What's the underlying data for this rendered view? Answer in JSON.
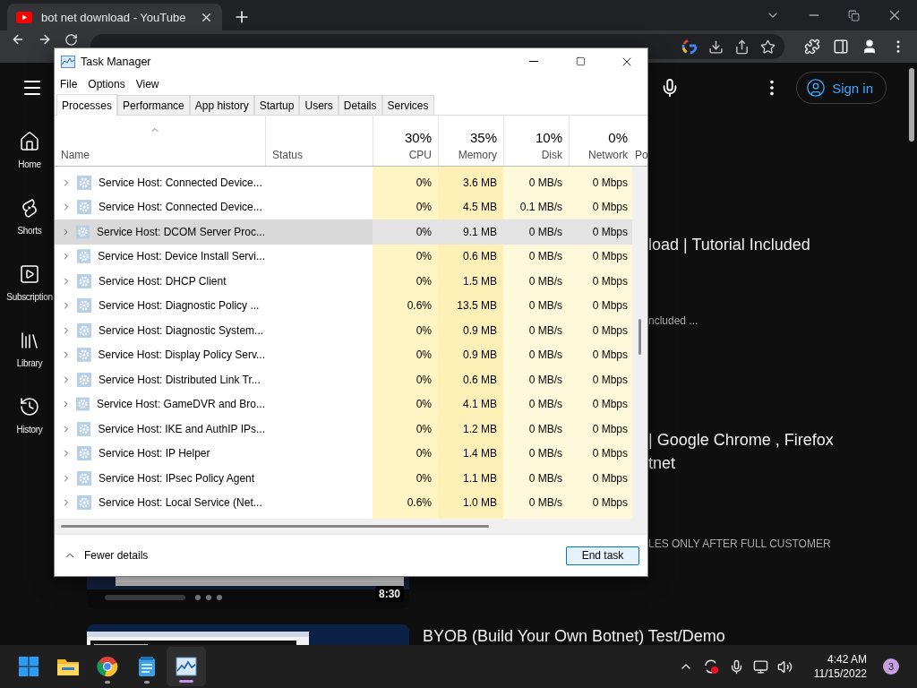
{
  "browser": {
    "tab_title": "bot net download - YouTube"
  },
  "youtube": {
    "sign_in": "Sign in",
    "sidebar": [
      {
        "kind": "home",
        "label": "Home"
      },
      {
        "kind": "shorts",
        "label": "Shorts"
      },
      {
        "kind": "subscriptions",
        "label": "Subscription"
      },
      {
        "kind": "library",
        "label": "Library"
      },
      {
        "kind": "history",
        "label": "History"
      }
    ],
    "results": [
      {
        "partly_hidden": true,
        "title_lines": [
          "load | Tutorial Included"
        ],
        "snippet": "ncluded ..."
      },
      {
        "partly_hidden": true,
        "thumbnail": {
          "kind": "picture"
        },
        "duration": "8:30",
        "title_lines": [
          "| Google Chrome , Firefox",
          "tnet"
        ],
        "description": "LES ONLY AFTER FULL CUSTOMER"
      },
      {
        "partly_hidden": false,
        "thumbnail": {
          "kind": "picture"
        },
        "title_lines": [
          "BYOB (Build Your Own Botnet) Test/Demo"
        ]
      }
    ]
  },
  "task_manager": {
    "title": "Task Manager",
    "menu": [
      "File",
      "Options",
      "View"
    ],
    "tabs": [
      {
        "label": "Processes",
        "selected": true
      },
      {
        "label": "Performance",
        "selected": false
      },
      {
        "label": "App history",
        "selected": false
      },
      {
        "label": "Startup",
        "selected": false
      },
      {
        "label": "Users",
        "selected": false
      },
      {
        "label": "Details",
        "selected": false
      },
      {
        "label": "Services",
        "selected": false
      }
    ],
    "columns": [
      {
        "label": "Name"
      },
      {
        "label": "Status"
      },
      {
        "label": "CPU",
        "total": "30%"
      },
      {
        "label": "Memory",
        "total": "35%"
      },
      {
        "label": "Disk",
        "total": "10%"
      },
      {
        "label": "Network",
        "total": "0%"
      },
      {
        "label": "Po"
      }
    ],
    "rows": [
      {
        "name": "Service Host: Connected Device...",
        "cpu": "0%",
        "memory": "3.6 MB",
        "disk": "0 MB/s",
        "network": "0 Mbps",
        "selected": false
      },
      {
        "name": "Service Host: Connected Device...",
        "cpu": "0%",
        "memory": "4.5 MB",
        "disk": "0.1 MB/s",
        "network": "0 Mbps",
        "selected": false
      },
      {
        "name": "Service Host: DCOM Server Proc...",
        "cpu": "0%",
        "memory": "9.1 MB",
        "disk": "0 MB/s",
        "network": "0 Mbps",
        "selected": true
      },
      {
        "name": "Service Host: Device Install Servi...",
        "cpu": "0%",
        "memory": "0.6 MB",
        "disk": "0 MB/s",
        "network": "0 Mbps",
        "selected": false
      },
      {
        "name": "Service Host: DHCP Client",
        "cpu": "0%",
        "memory": "1.5 MB",
        "disk": "0 MB/s",
        "network": "0 Mbps",
        "selected": false
      },
      {
        "name": "Service Host: Diagnostic Policy ...",
        "cpu": "0.6%",
        "memory": "13.5 MB",
        "disk": "0 MB/s",
        "network": "0 Mbps",
        "selected": false
      },
      {
        "name": "Service Host: Diagnostic System...",
        "cpu": "0%",
        "memory": "0.9 MB",
        "disk": "0 MB/s",
        "network": "0 Mbps",
        "selected": false
      },
      {
        "name": "Service Host: Display Policy Serv...",
        "cpu": "0%",
        "memory": "0.9 MB",
        "disk": "0 MB/s",
        "network": "0 Mbps",
        "selected": false
      },
      {
        "name": "Service Host: Distributed Link Tr...",
        "cpu": "0%",
        "memory": "0.6 MB",
        "disk": "0 MB/s",
        "network": "0 Mbps",
        "selected": false
      },
      {
        "name": "Service Host: GameDVR and Bro...",
        "cpu": "0%",
        "memory": "4.1 MB",
        "disk": "0 MB/s",
        "network": "0 Mbps",
        "selected": false
      },
      {
        "name": "Service Host: IKE and AuthIP IPs...",
        "cpu": "0%",
        "memory": "1.2 MB",
        "disk": "0 MB/s",
        "network": "0 Mbps",
        "selected": false
      },
      {
        "name": "Service Host: IP Helper",
        "cpu": "0%",
        "memory": "1.4 MB",
        "disk": "0 MB/s",
        "network": "0 Mbps",
        "selected": false
      },
      {
        "name": "Service Host: IPsec Policy Agent",
        "cpu": "0%",
        "memory": "1.1 MB",
        "disk": "0 MB/s",
        "network": "0 Mbps",
        "selected": false
      },
      {
        "name": "Service Host: Local Service (Net...",
        "cpu": "0.6%",
        "memory": "1.0 MB",
        "disk": "0 MB/s",
        "network": "0 Mbps",
        "selected": false
      }
    ],
    "footer": {
      "toggle": "Fewer details",
      "button": "End task"
    }
  },
  "taskbar": {
    "apps": [
      {
        "kind": "start",
        "running": false,
        "active": false
      },
      {
        "kind": "explorer",
        "running": false,
        "active": false
      },
      {
        "kind": "chrome",
        "running": true,
        "active": false
      },
      {
        "kind": "notepad",
        "running": true,
        "active": false
      },
      {
        "kind": "taskmgr",
        "running": true,
        "active": true
      }
    ],
    "time": "4:42 AM",
    "date": "11/15/2022",
    "notifications": "3"
  }
}
